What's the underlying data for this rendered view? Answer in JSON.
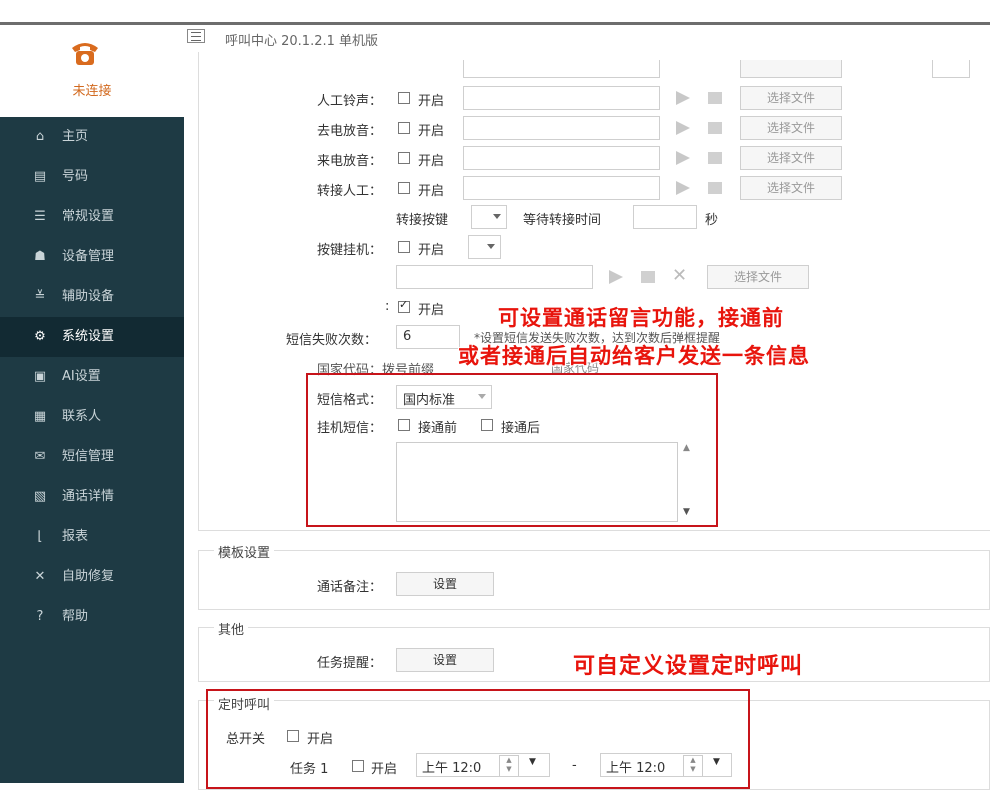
{
  "app": {
    "title": "呼叫中心 20.1.2.1 单机版",
    "connection_status": "未连接"
  },
  "sidebar": {
    "items": [
      {
        "icon": "home-icon",
        "glyph": "⌂",
        "label": "主页"
      },
      {
        "icon": "contact-card-icon",
        "glyph": "▤",
        "label": "号码"
      },
      {
        "icon": "sliders-icon",
        "glyph": "☰",
        "label": "常规设置"
      },
      {
        "icon": "device-icon",
        "glyph": "☗",
        "label": "设备管理"
      },
      {
        "icon": "aux-device-icon",
        "glyph": "≚",
        "label": "辅助设备"
      },
      {
        "icon": "gear-icon",
        "glyph": "⚙",
        "label": "系统设置",
        "active": true
      },
      {
        "icon": "ai-icon",
        "glyph": "▣",
        "label": "AI设置"
      },
      {
        "icon": "contact-icon",
        "glyph": "▦",
        "label": "联系人"
      },
      {
        "icon": "mail-icon",
        "glyph": "✉",
        "label": "短信管理"
      },
      {
        "icon": "call-detail-icon",
        "glyph": "▧",
        "label": "通话详情"
      },
      {
        "icon": "chart-icon",
        "glyph": "⌊",
        "label": "报表"
      },
      {
        "icon": "repair-icon",
        "glyph": "✕",
        "label": "自助修复"
      },
      {
        "icon": "help-icon",
        "glyph": "?",
        "label": "帮助"
      }
    ]
  },
  "form": {
    "rows": [
      {
        "label": "人工铃声：",
        "option": "开启",
        "button": "选择文件"
      },
      {
        "label": "去电放音：",
        "option": "开启",
        "button": "选择文件"
      },
      {
        "label": "来电放音：",
        "option": "开启",
        "button": "选择文件"
      },
      {
        "label": "转接人工：",
        "option": "开启",
        "button": "选择文件"
      }
    ],
    "transfer_key_label": "转接按键",
    "wait_time_label": "等待转接时间",
    "seconds_label": "秒",
    "hangup_key_label": "按键挂机：",
    "hangup_key_option": "开启",
    "hangup_file_button": "选择文件",
    "enabled_option": "开启",
    "sms_fail_label": "短信失败次数：",
    "sms_fail_value": "6",
    "sms_fail_hint": "*设置短信发送失败次数，达到次数后弹框提醒",
    "country_code_label": "国家代码：拨号前缀",
    "country_code_hint": "国家代码",
    "sms_format_label": "短信格式：",
    "sms_format_value": "国内标准",
    "hangup_sms_label": "挂机短信：",
    "before_connect": "接通前",
    "after_connect": "接通后"
  },
  "template_section": {
    "title": "模板设置",
    "call_note_label": "通话备注：",
    "call_note_button": "设置"
  },
  "other_section": {
    "title": "其他",
    "task_reminder_label": "任务提醒：",
    "task_reminder_button": "设置"
  },
  "timer_section": {
    "title": "定时呼叫",
    "master_switch_label": "总开关",
    "master_switch_option": "开启",
    "task_label": "任务 1",
    "task_option": "开启",
    "start_time": "上午 12:0",
    "separator": "-",
    "end_time": "上午 12:0"
  },
  "annotations": {
    "sms_line1": "可设置通话留言功能，接通前",
    "sms_line2": "或者接通后自动给客户发送一条信息",
    "timer": "可自定义设置定时呼叫"
  },
  "colors": {
    "sidebar_bg": "#1e3a44",
    "sidebar_active": "#122a33",
    "annotation_red": "#e8140c",
    "connection_orange": "#d2691e"
  }
}
